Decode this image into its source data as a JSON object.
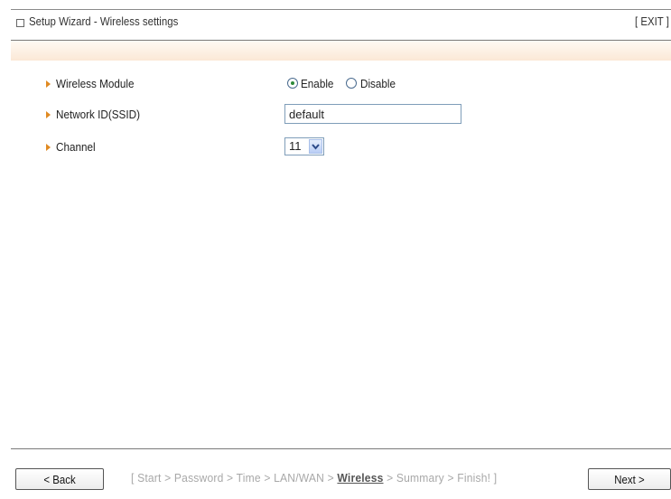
{
  "header": {
    "title": "Setup Wizard - Wireless settings",
    "exit_label": "[ EXIT ]"
  },
  "form": {
    "wireless_module": {
      "label": "Wireless Module",
      "options": [
        {
          "label": "Enable",
          "checked": true
        },
        {
          "label": "Disable",
          "checked": false
        }
      ]
    },
    "ssid": {
      "label": "Network ID(SSID)",
      "value": "default"
    },
    "channel": {
      "label": "Channel",
      "value": "11"
    }
  },
  "footer": {
    "back_label": "< Back",
    "next_label": "Next >",
    "steps": {
      "open": "[ ",
      "step_start": "Start",
      "step_password": "Password",
      "step_time": "Time",
      "step_lanwan": "LAN/WAN",
      "step_wireless": "Wireless",
      "step_summary": "Summary",
      "step_finish": "Finish!",
      "separator": " > ",
      "close": " ]"
    }
  },
  "colors": {
    "arrow": "#e08a22",
    "radio_dot": "#2e8b3a",
    "input_border": "#7f9db9",
    "band_bottom": "#fbe8d6",
    "steps_inactive": "#a8a8a8",
    "steps_current": "#555555"
  },
  "icons": {
    "header": "window-icon",
    "row_bullet": "triangle-right-icon",
    "dropdown": "chevron-down-icon"
  }
}
